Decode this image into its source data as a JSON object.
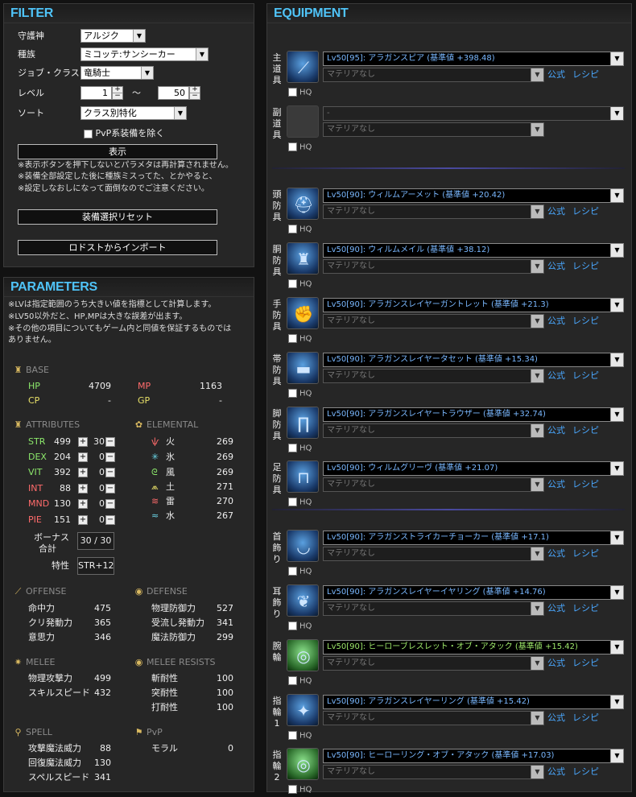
{
  "filter": {
    "title": "FILTER",
    "guardian_label": "守護神",
    "guardian_value": "アルジク",
    "race_label": "種族",
    "race_value": "ミコッテ:サンシーカー",
    "job_label": "ジョブ・クラス",
    "job_value": "竜騎士",
    "level_label": "レベル",
    "level_min": "1",
    "level_tilde": "～",
    "level_max": "50",
    "sort_label": "ソート",
    "sort_value": "クラス別特化",
    "pvp_label": "PvP系装備を除く",
    "show_button": "表示",
    "note1": "※表示ボタンを押下しないとパラメタは再計算されません。",
    "note2": "※装備全部設定した後に種族ミスってた、とかやると、",
    "note3": "※設定しなおしになって面倒なのでご注意ください。",
    "reset_button": "装備選択リセット",
    "import_button": "ロドストからインポート"
  },
  "parameters": {
    "title": "PARAMETERS",
    "note1": "※LVは指定範囲のうち大きい値を指標として計算します。",
    "note2": "※LV50以外だと、HP,MPは大きな誤差が出ます。",
    "note3": "※その他の項目についてもゲーム内と同値を保証するものでは",
    "note4": "ありません。",
    "base": {
      "header": "BASE",
      "hp_label": "HP",
      "hp": "4709",
      "mp_label": "MP",
      "mp": "1163",
      "cp_label": "CP",
      "cp": "-",
      "gp_label": "GP",
      "gp": "-"
    },
    "attributes_header": "ATTRIBUTES",
    "attributes": [
      {
        "label": "STR",
        "value": "499",
        "bonus": "30"
      },
      {
        "label": "DEX",
        "value": "204",
        "bonus": "0"
      },
      {
        "label": "VIT",
        "value": "392",
        "bonus": "0"
      },
      {
        "label": "INT",
        "value": "88",
        "bonus": "0"
      },
      {
        "label": "MND",
        "value": "130",
        "bonus": "0"
      },
      {
        "label": "PIE",
        "value": "151",
        "bonus": "0"
      }
    ],
    "plus": "+",
    "minus": "−",
    "bonus_total_label1": "ボーナス",
    "bonus_total_label2": "合計",
    "bonus_total": "30 / 30",
    "trait_label": "特性",
    "trait_value": "STR+12",
    "elemental_header": "ELEMENTAL",
    "elemental": [
      {
        "label": "火",
        "value": "269"
      },
      {
        "label": "氷",
        "value": "269"
      },
      {
        "label": "風",
        "value": "269"
      },
      {
        "label": "土",
        "value": "271"
      },
      {
        "label": "雷",
        "value": "270"
      },
      {
        "label": "水",
        "value": "267"
      }
    ],
    "offense": {
      "header": "OFFENSE",
      "rows": [
        {
          "label": "命中力",
          "value": "475"
        },
        {
          "label": "クリ発動力",
          "value": "365"
        },
        {
          "label": "意思力",
          "value": "346"
        }
      ]
    },
    "defense": {
      "header": "DEFENSE",
      "rows": [
        {
          "label": "物理防御力",
          "value": "527"
        },
        {
          "label": "受流し発動力",
          "value": "341"
        },
        {
          "label": "魔法防御力",
          "value": "299"
        }
      ]
    },
    "melee": {
      "header": "MELEE",
      "rows": [
        {
          "label": "物理攻撃力",
          "value": "499"
        },
        {
          "label": "スキルスピード",
          "value": "432"
        }
      ]
    },
    "melee_resists": {
      "header": "MELEE RESISTS",
      "rows": [
        {
          "label": "斬耐性",
          "value": "100"
        },
        {
          "label": "突耐性",
          "value": "100"
        },
        {
          "label": "打耐性",
          "value": "100"
        }
      ]
    },
    "spell": {
      "header": "SPELL",
      "rows": [
        {
          "label": "攻撃魔法威力",
          "value": "88"
        },
        {
          "label": "回復魔法威力",
          "value": "130"
        },
        {
          "label": "スペルスピード",
          "value": "341"
        }
      ]
    },
    "pvp": {
      "header": "PvP",
      "rows": [
        {
          "label": "モラル",
          "value": "0"
        }
      ]
    }
  },
  "equipment": {
    "title": "EQUIPMENT",
    "hq_label": "HQ",
    "materia_none": "マテリアなし",
    "official_link": "公式",
    "recipe_link": "レシピ",
    "slots": [
      {
        "label1": "主",
        "label2": "道",
        "label3": "具",
        "item": "Lv50[95]: アラガンスピア (基準値 +398.48)",
        "icon": "spear-icon"
      },
      {
        "label1": "副",
        "label2": "道",
        "label3": "具",
        "item": "-",
        "icon": "empty-slot-icon"
      },
      {
        "label1": "頭",
        "label2": "防",
        "label3": "具",
        "item": "Lv50[90]: ウィルムアーメット (基準値 +20.42)",
        "icon": "helmet-icon"
      },
      {
        "label1": "胴",
        "label2": "防",
        "label3": "具",
        "item": "Lv50[90]: ウィルムメイル (基準値 +38.12)",
        "icon": "armor-icon"
      },
      {
        "label1": "手",
        "label2": "防",
        "label3": "具",
        "item": "Lv50[90]: アラガンスレイヤーガントレット (基準値 +21.3)",
        "icon": "gauntlet-icon"
      },
      {
        "label1": "帯",
        "label2": "防",
        "label3": "具",
        "item": "Lv50[90]: アラガンスレイヤータセット (基準値 +15.34)",
        "icon": "belt-icon"
      },
      {
        "label1": "脚",
        "label2": "防",
        "label3": "具",
        "item": "Lv50[90]: アラガンスレイヤートラウザー (基準値 +32.74)",
        "icon": "legs-icon"
      },
      {
        "label1": "足",
        "label2": "防",
        "label3": "具",
        "item": "Lv50[90]: ウィルムグリーヴ (基準値 +21.07)",
        "icon": "boots-icon"
      },
      {
        "label1": "首",
        "label2": "飾",
        "label3": "り",
        "item": "Lv50[90]: アラガンストライカーチョーカー (基準値 +17.1)",
        "icon": "choker-icon"
      },
      {
        "label1": "耳",
        "label2": "飾",
        "label3": "り",
        "item": "Lv50[90]: アラガンスレイヤーイヤリング (基準値 +14.76)",
        "icon": "earring-icon"
      },
      {
        "label1": "腕",
        "label2": "輪",
        "label3": "",
        "item": "Lv50[90]: ヒーローブレスレット・オブ・アタック (基準値 +15.42)",
        "icon": "bracelet-icon"
      },
      {
        "label1": "指",
        "label2": "輪",
        "label3": "1",
        "item": "Lv50[90]: アラガンスレイヤーリング (基準値 +15.42)",
        "icon": "ring-icon"
      },
      {
        "label1": "指",
        "label2": "輪",
        "label3": "2",
        "item": "Lv50[90]: ヒーローリング・オブ・アタック (基準値 +17.03)",
        "icon": "ring-green-icon"
      }
    ]
  }
}
